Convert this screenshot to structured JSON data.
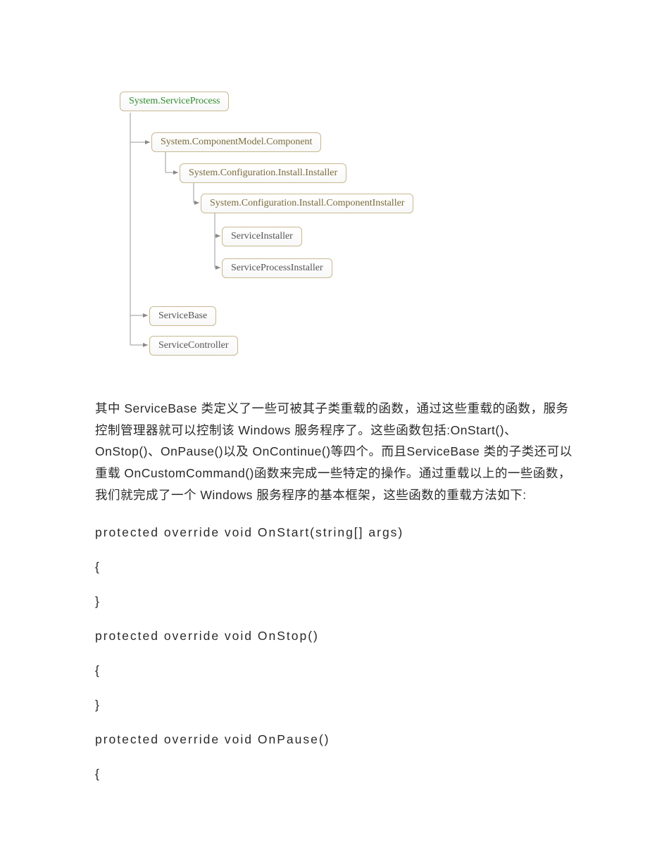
{
  "diagram": {
    "root": "System.ServiceProcess",
    "n1": "System.ComponentModel.Component",
    "n2": "System.Configuration.Install.Installer",
    "n3": "System.Configuration.Install.ComponentInstaller",
    "n4": "ServiceInstaller",
    "n5": "ServiceProcessInstaller",
    "n6": "ServiceBase",
    "n7": "ServiceController"
  },
  "paragraph": "其中 ServiceBase 类定义了一些可被其子类重载的函数，通过这些重载的函数，服务控制管理器就可以控制该 Windows 服务程序了。这些函数包括:OnStart()、OnStop()、OnPause()以及 OnContinue()等四个。而且ServiceBase 类的子类还可以重载 OnCustomCommand()函数来完成一些特定的操作。通过重载以上的一些函数，我们就完成了一个 Windows 服务程序的基本框架，这些函数的重载方法如下:",
  "code": {
    "l1": "protected override void OnStart(string[] args)",
    "l2": "{",
    "l3": "}",
    "l4": "protected override void OnStop()",
    "l5": "{",
    "l6": "}",
    "l7": "protected override void OnPause()",
    "l8": "{"
  }
}
